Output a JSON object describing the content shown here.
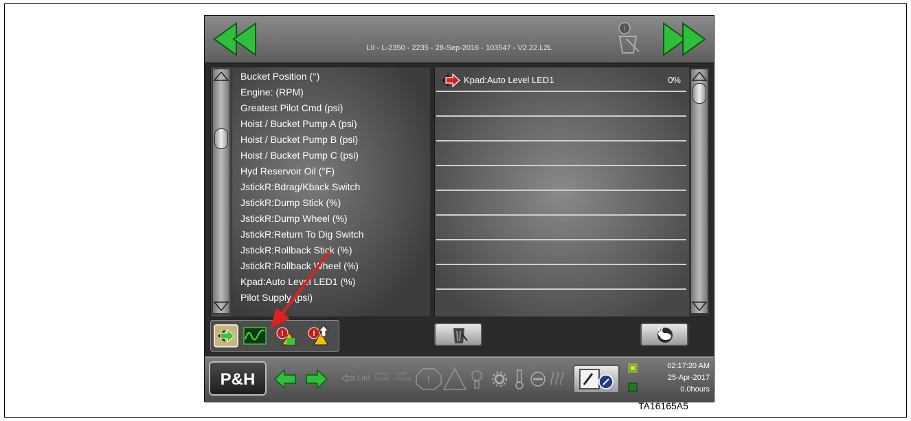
{
  "header": {
    "title": "LII - L-2350 - 2235 - 28-Sep-2016 - 103547 - V2.22.L2L",
    "icons": [
      "left-arrow-icon",
      "right-arrow-icon",
      "trash-alert-icon"
    ]
  },
  "signal_list": {
    "items": [
      "Bucket Position (°)",
      "Engine: (RPM)",
      "Greatest Pilot Cmd (psi)",
      "Hoist / Bucket Pump A (psi)",
      "Hoist / Bucket Pump B (psi)",
      "Hoist / Bucket Pump C (psi)",
      "Hyd Reservoir Oil (°F)",
      "JstickR:Bdrag/Kback Switch",
      "JstickR:Dump Stick (%)",
      "JstickR:Dump Wheel (%)",
      "JstickR:Return To Dig Switch",
      "JstickR:Rollback Stick (%)",
      "JstickR:Rollback Wheel (%)",
      "Kpad:Auto Level LED1 (%)",
      "Pilot Supply (psi)"
    ]
  },
  "selected_table": {
    "rows": [
      {
        "label": "Kpad:Auto Level LED1",
        "value": "0%"
      },
      {
        "label": "",
        "value": ""
      },
      {
        "label": "",
        "value": ""
      },
      {
        "label": "",
        "value": ""
      },
      {
        "label": "",
        "value": ""
      },
      {
        "label": "",
        "value": ""
      },
      {
        "label": "",
        "value": ""
      },
      {
        "label": "",
        "value": ""
      },
      {
        "label": "",
        "value": ""
      },
      {
        "label": "",
        "value": ""
      }
    ]
  },
  "status_bar": {
    "logo": "P&H",
    "time": "02:17:20 AM",
    "date": "25-Apr-2017",
    "hours": "0.0hours",
    "ghost_labels": {
      "lim": "LIM",
      "check": "CHECK\nENGINE",
      "stop": "STOP\nENGINE"
    }
  },
  "figure_label": "TA16165A5",
  "colors": {
    "accent_green": "#22aa33",
    "arrow_red": "#e02020"
  }
}
